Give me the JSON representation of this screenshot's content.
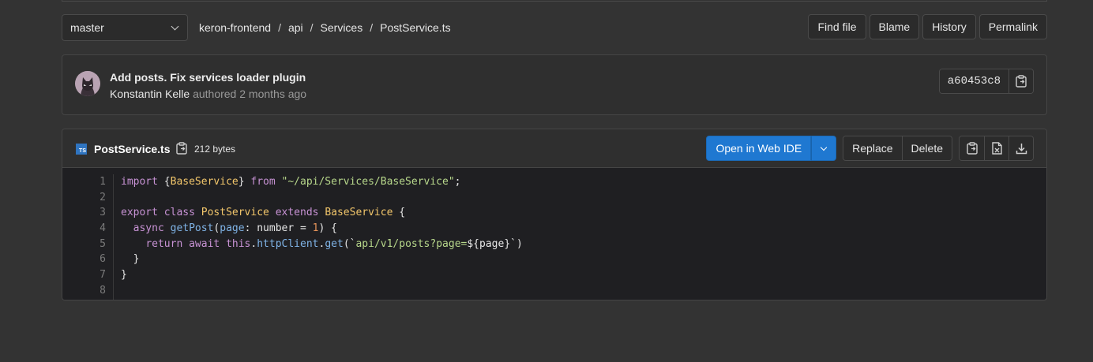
{
  "branch": {
    "label": "master"
  },
  "breadcrumb": {
    "items": [
      "keron-frontend",
      "api",
      "Services",
      "PostService.ts"
    ],
    "separator": "/"
  },
  "file_actions": {
    "find_file": "Find file",
    "blame": "Blame",
    "history": "History",
    "permalink": "Permalink"
  },
  "commit": {
    "title": "Add posts. Fix services loader plugin",
    "author": "Konstantin Kelle",
    "authored_text": "authored 2 months ago",
    "sha": "a60453c8"
  },
  "file": {
    "name": "PostService.ts",
    "size": "212 bytes",
    "type_icon": "typescript-file-icon",
    "open_ide_label": "Open in Web IDE",
    "replace_label": "Replace",
    "delete_label": "Delete"
  },
  "code": {
    "line_numbers": [
      "1",
      "2",
      "3",
      "4",
      "5",
      "6",
      "7",
      "8"
    ],
    "lines": [
      "import {BaseService} from \"~/api/Services/BaseService\";",
      "",
      "export class PostService extends BaseService {",
      "  async getPost(page: number = 1) {",
      "    return await this.httpClient.get(`api/v1/posts?page=${page}`)",
      "  }",
      "}",
      ""
    ]
  },
  "colors": {
    "background": "#333333",
    "primary_button": "#1f78d1",
    "code_background": "#1f1f22",
    "keyword": "#c792d4",
    "class_name": "#f2c66b",
    "string": "#b7d78b",
    "number": "#e8955a",
    "function": "#7fb3e6"
  }
}
